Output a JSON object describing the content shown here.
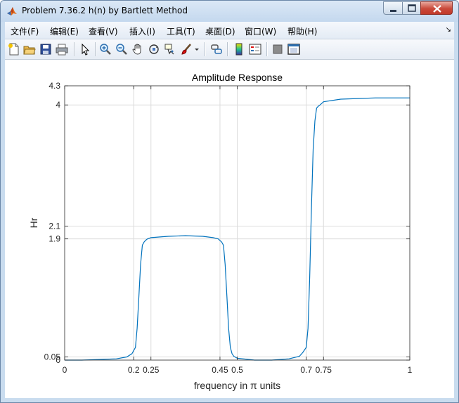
{
  "window": {
    "title": "Problem 7.36.2 h(n) by Bartlett Method",
    "accent_color": "#c9dcef",
    "close_color": "#c9493a"
  },
  "menu": {
    "items": [
      {
        "id": "file",
        "label": "文件(F)"
      },
      {
        "id": "edit",
        "label": "编辑(E)"
      },
      {
        "id": "view",
        "label": "查看(V)"
      },
      {
        "id": "insert",
        "label": "插入(I)"
      },
      {
        "id": "tools",
        "label": "工具(T)"
      },
      {
        "id": "desktop",
        "label": "桌面(D)"
      },
      {
        "id": "window",
        "label": "窗口(W)"
      },
      {
        "id": "help",
        "label": "帮助(H)"
      }
    ],
    "overflow_icon": "chevron-double-down-icon"
  },
  "toolbar": {
    "icons": [
      "new-figure-icon",
      "open-file-icon",
      "save-icon",
      "print-icon",
      "select-arrow-icon",
      "zoom-in-icon",
      "zoom-out-icon",
      "pan-hand-icon",
      "rotate-3d-icon",
      "data-cursor-icon",
      "brush-icon",
      "brush-dropdown-icon",
      "link-plot-icon",
      "colorbar-icon",
      "legend-icon",
      "hide-plot-tools-icon",
      "show-plot-tools-icon"
    ]
  },
  "chart_data": {
    "type": "line",
    "title": "Amplitude Response",
    "xlabel": "frequency in π units",
    "ylabel": "Hr",
    "xlim": [
      0,
      1
    ],
    "ylim": [
      0,
      4.3
    ],
    "grid": "custom",
    "x_ticks": [
      0,
      0.2,
      0.25,
      0.45,
      0.5,
      0.7,
      0.75,
      1
    ],
    "x_tick_labels": [
      "0",
      "0.2",
      "0.25",
      "0.45",
      "0.5",
      "0.7",
      "0.75",
      "1"
    ],
    "y_ticks": [
      0,
      0.05,
      1.9,
      2.1,
      4,
      4.3
    ],
    "y_tick_labels": [
      "0",
      "0.05",
      "1.9",
      "2.1",
      "4",
      "4.3"
    ],
    "line_color": "#0072bd",
    "series": [
      {
        "x": [
          0,
          0.05,
          0.1,
          0.15,
          0.18,
          0.195,
          0.205,
          0.21,
          0.215,
          0.22,
          0.225,
          0.23,
          0.235,
          0.24,
          0.25,
          0.3,
          0.35,
          0.4,
          0.43,
          0.445,
          0.455,
          0.46,
          0.465,
          0.47,
          0.475,
          0.48,
          0.485,
          0.49,
          0.5,
          0.55,
          0.6,
          0.65,
          0.68,
          0.69,
          0.7,
          0.705,
          0.71,
          0.715,
          0.72,
          0.725,
          0.73,
          0.735,
          0.74,
          0.75,
          0.8,
          0.85,
          0.9,
          0.95,
          1.0
        ],
        "y": [
          0.0,
          0.0,
          0.01,
          0.02,
          0.05,
          0.1,
          0.2,
          0.5,
          1.0,
          1.5,
          1.8,
          1.85,
          1.88,
          1.9,
          1.92,
          1.94,
          1.95,
          1.94,
          1.92,
          1.9,
          1.85,
          1.8,
          1.5,
          1.0,
          0.5,
          0.2,
          0.1,
          0.06,
          0.03,
          0.0,
          0.0,
          0.02,
          0.06,
          0.12,
          0.2,
          0.5,
          1.3,
          2.4,
          3.3,
          3.75,
          3.95,
          3.98,
          4.0,
          4.05,
          4.09,
          4.1,
          4.11,
          4.11,
          4.11
        ]
      }
    ]
  }
}
